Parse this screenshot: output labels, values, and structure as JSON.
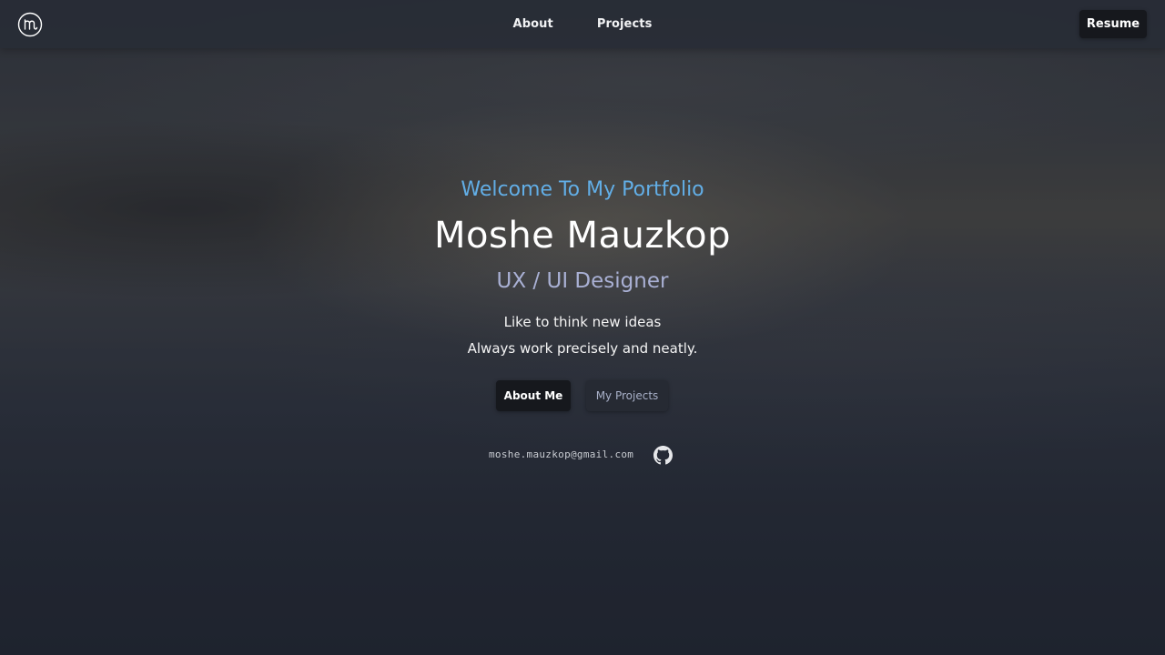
{
  "nav": {
    "logo_icon": "m-circle-logo-icon",
    "links": [
      {
        "label": "About"
      },
      {
        "label": "Projects"
      }
    ],
    "resume_label": "Resume"
  },
  "hero": {
    "welcome": "Welcome To My Portfolio",
    "name": "Moshe Mauzkop",
    "role": "UX / UI Designer",
    "tagline_1": "Like to think new ideas",
    "tagline_2": "Always work precisely and neatly.",
    "buttons": {
      "about_me": "About Me",
      "my_projects": "My Projects"
    },
    "email": "moshe.mauzkop@gmail.com",
    "github_icon": "github-icon"
  },
  "colors": {
    "accent_blue": "#62aee6",
    "role_lavender": "#a9b0d4",
    "button_dark": "#16181d",
    "navbar": "#282c36"
  }
}
